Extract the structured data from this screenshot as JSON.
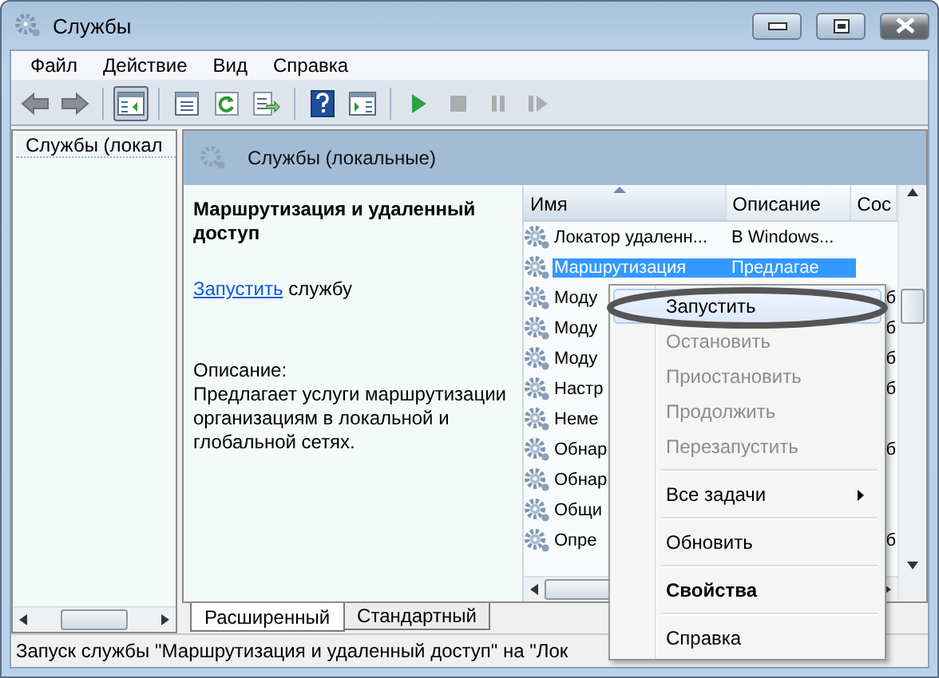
{
  "window": {
    "title": "Службы"
  },
  "menu": [
    "Файл",
    "Действие",
    "Вид",
    "Справка"
  ],
  "toolbar": [
    {
      "kind": "back",
      "disabled": false,
      "pressed": false
    },
    {
      "kind": "forward",
      "disabled": false,
      "pressed": false
    },
    {
      "kind": "separator"
    },
    {
      "kind": "tree",
      "disabled": false,
      "pressed": true
    },
    {
      "kind": "separator"
    },
    {
      "kind": "properties",
      "disabled": false,
      "pressed": false
    },
    {
      "kind": "refresh",
      "disabled": false,
      "pressed": false
    },
    {
      "kind": "export",
      "disabled": false,
      "pressed": false
    },
    {
      "kind": "separator"
    },
    {
      "kind": "help",
      "disabled": false,
      "pressed": false
    },
    {
      "kind": "pane",
      "disabled": false,
      "pressed": false
    },
    {
      "kind": "separator"
    },
    {
      "kind": "play",
      "disabled": false,
      "pressed": false
    },
    {
      "kind": "stop",
      "disabled": true,
      "pressed": false
    },
    {
      "kind": "pause",
      "disabled": true,
      "pressed": false
    },
    {
      "kind": "resume",
      "disabled": true,
      "pressed": false
    }
  ],
  "tree": {
    "items": [
      {
        "label": "Службы (локал"
      }
    ]
  },
  "header": {
    "title": "Службы (локальные)"
  },
  "details": {
    "title": "Маршрутизация и удаленный доступ",
    "link": "Запустить",
    "link_suffix": "службу",
    "description_label": "Описание:",
    "description": "Предлагает услуги маршрутизации организациям в локальной и глобальной сетях."
  },
  "table": {
    "columns": [
      {
        "label": "Имя",
        "sorted": true
      },
      {
        "label": "Описание",
        "sorted": false
      },
      {
        "label": "Сос",
        "sorted": false
      }
    ],
    "rows": [
      {
        "name": "Локатор удаленн...",
        "description": "В Windows...",
        "selected": false
      },
      {
        "name": "Маршрутизация",
        "description": "Предлагае",
        "selected": true
      },
      {
        "name": "Моду",
        "tail": "б",
        "selected": false
      },
      {
        "name": "Моду",
        "tail": "б",
        "selected": false
      },
      {
        "name": "Моду",
        "tail": "б",
        "selected": false
      },
      {
        "name": "Настр",
        "tail": "б",
        "selected": false
      },
      {
        "name": "Неме",
        "selected": false
      },
      {
        "name": "Обнар",
        "tail": "б",
        "selected": false
      },
      {
        "name": "Обнар",
        "selected": false
      },
      {
        "name": "Общи",
        "selected": false
      },
      {
        "name": "Опре",
        "tail": "б",
        "selected": false
      }
    ]
  },
  "view_tabs": [
    {
      "label": "Расширенный",
      "selected": true
    },
    {
      "label": "Стандартный",
      "selected": false
    }
  ],
  "status_bar": "Запуск службы \"Маршрутизация и удаленный доступ\" на \"Лок",
  "context_menu": {
    "items": [
      {
        "kind": "item",
        "label": "Запустить",
        "disabled": false,
        "highlighted": true,
        "default": false,
        "circled": true
      },
      {
        "kind": "item",
        "label": "Остановить",
        "disabled": true,
        "highlighted": false,
        "default": false,
        "circled": false
      },
      {
        "kind": "item",
        "label": "Приостановить",
        "disabled": true,
        "highlighted": false,
        "default": false,
        "circled": false
      },
      {
        "kind": "item",
        "label": "Продолжить",
        "disabled": true,
        "highlighted": false,
        "default": false,
        "circled": false
      },
      {
        "kind": "item",
        "label": "Перезапустить",
        "disabled": true,
        "highlighted": false,
        "default": false,
        "circled": false
      },
      {
        "kind": "separator"
      },
      {
        "kind": "submenu",
        "label": "Все задачи",
        "disabled": false,
        "highlighted": false,
        "default": false,
        "circled": false
      },
      {
        "kind": "separator"
      },
      {
        "kind": "item",
        "label": "Обновить",
        "disabled": false,
        "highlighted": false,
        "default": false,
        "circled": false
      },
      {
        "kind": "separator"
      },
      {
        "kind": "item",
        "label": "Свойства",
        "disabled": false,
        "highlighted": false,
        "default": true,
        "circled": false
      },
      {
        "kind": "separator"
      },
      {
        "kind": "item",
        "label": "Справка",
        "disabled": false,
        "highlighted": false,
        "default": false,
        "circled": false
      }
    ]
  }
}
